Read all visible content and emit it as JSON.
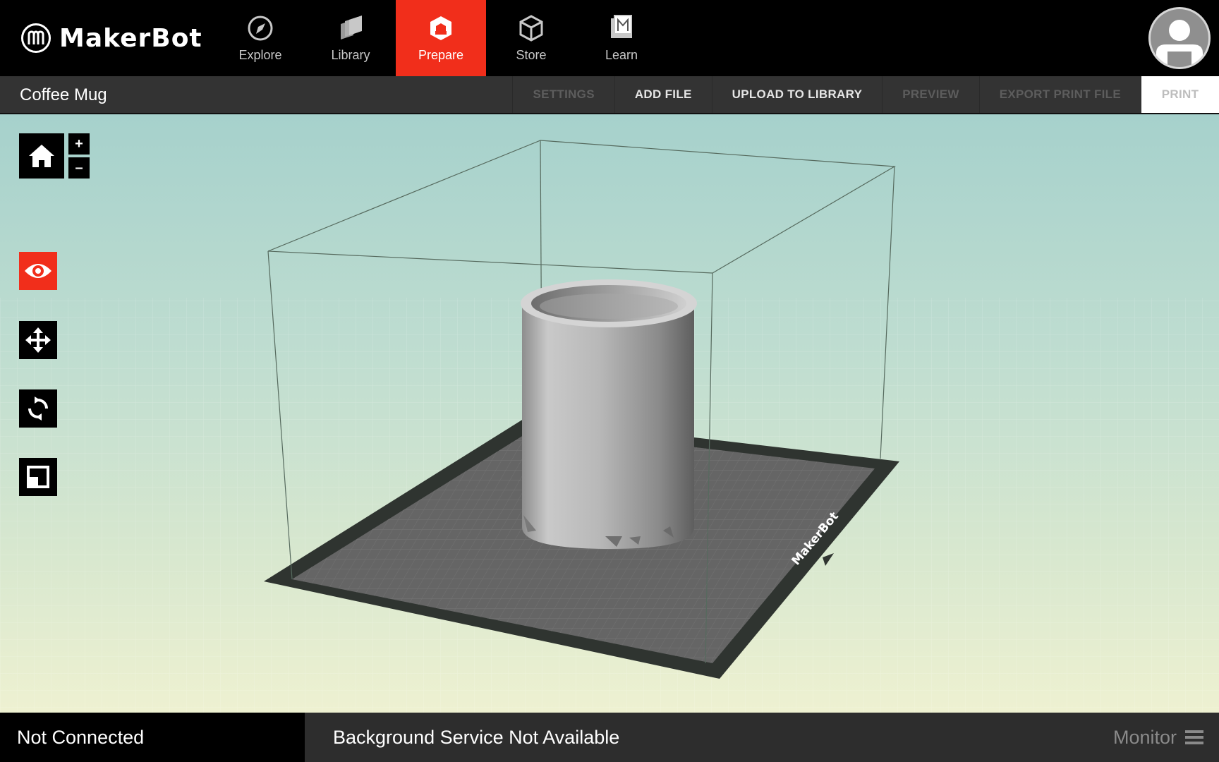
{
  "brand": {
    "name": "MakerBot"
  },
  "nav": {
    "items": [
      {
        "label": "Explore",
        "icon": "compass-icon"
      },
      {
        "label": "Library",
        "icon": "library-icon"
      },
      {
        "label": "Prepare",
        "icon": "prepare-icon",
        "active": true
      },
      {
        "label": "Store",
        "icon": "cube-icon"
      },
      {
        "label": "Learn",
        "icon": "book-icon"
      }
    ],
    "active_color": "#f12e1b"
  },
  "user": {
    "avatar_icon": "user-avatar-icon"
  },
  "project": {
    "title": "Coffee Mug"
  },
  "toolbar": {
    "actions": [
      {
        "label": "SETTINGS",
        "enabled": false
      },
      {
        "label": "ADD FILE",
        "enabled": true
      },
      {
        "label": "UPLOAD TO LIBRARY",
        "enabled": true
      },
      {
        "label": "PREVIEW",
        "enabled": false
      },
      {
        "label": "EXPORT PRINT FILE",
        "enabled": false
      },
      {
        "label": "PRINT",
        "enabled": false
      }
    ]
  },
  "view_controls": {
    "home_icon": "home-icon",
    "zoom_in": "+",
    "zoom_out": "–",
    "tools": [
      {
        "name": "view",
        "icon": "eye-icon",
        "active": true
      },
      {
        "name": "move",
        "icon": "move-arrows-icon",
        "active": false
      },
      {
        "name": "rotate",
        "icon": "rotate-icon",
        "active": false
      },
      {
        "name": "scale",
        "icon": "scale-icon",
        "active": false
      }
    ]
  },
  "build_plate": {
    "brand_mark": "MakerBot"
  },
  "status": {
    "connection": "Not Connected",
    "service": "Background Service Not Available",
    "monitor_label": "Monitor"
  }
}
